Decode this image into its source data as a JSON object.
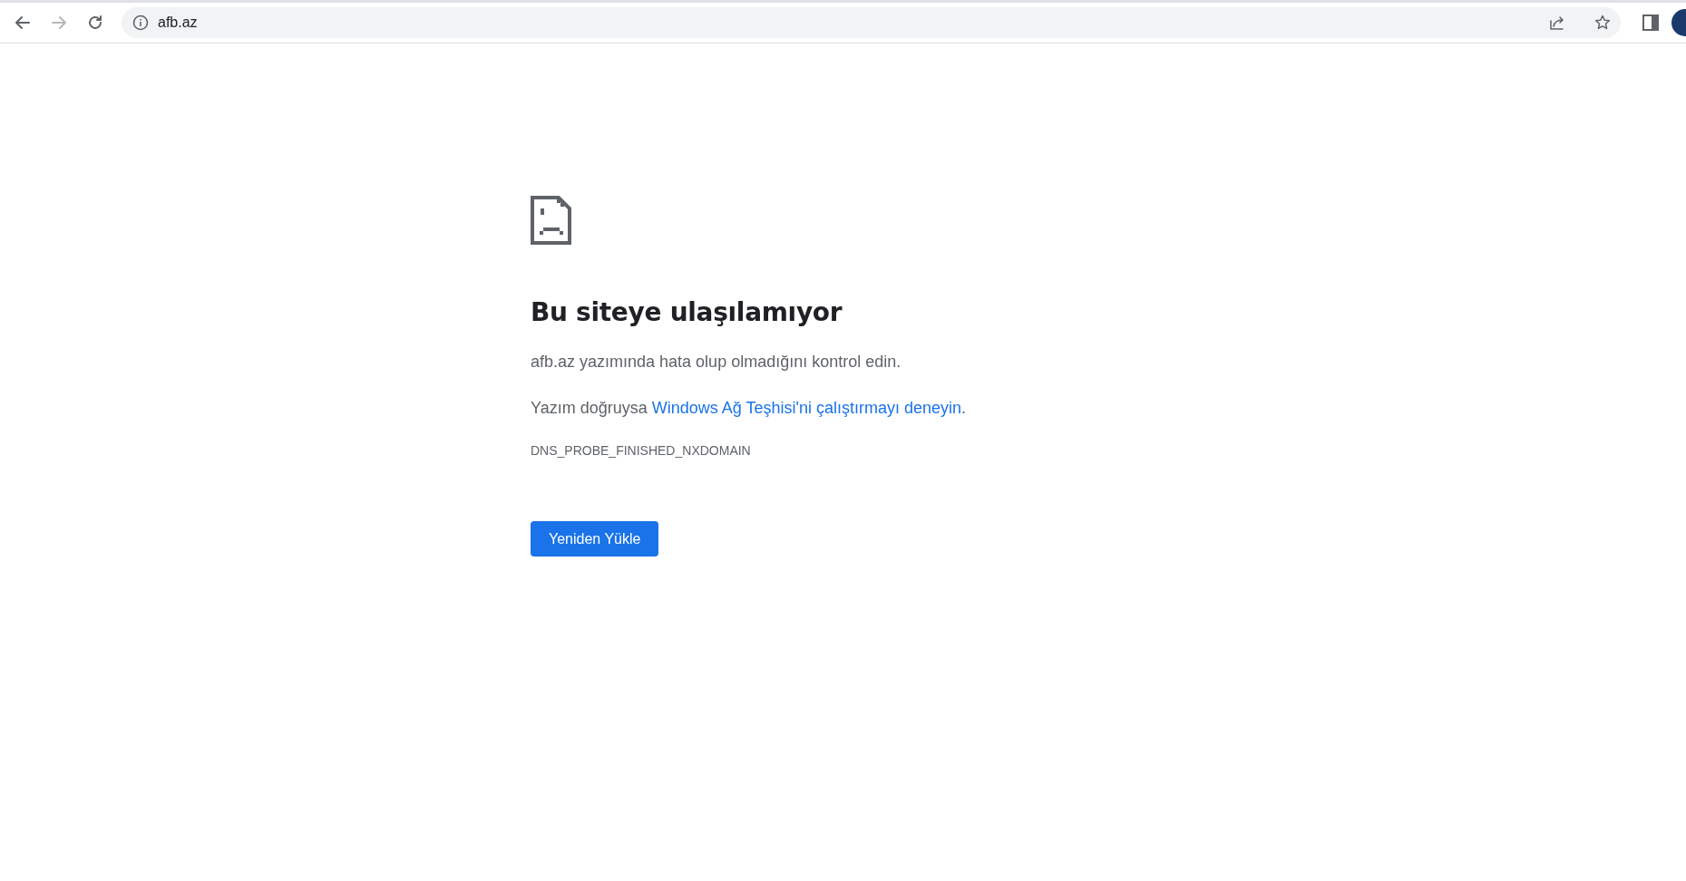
{
  "toolbar": {
    "back": {
      "disabled": false
    },
    "forward": {
      "disabled": true
    },
    "address": "afb.az"
  },
  "error": {
    "title": "Bu siteye ulaşılamıyor",
    "summary": "afb.az yazımında hata olup olmadığını kontrol edin.",
    "suggestion": {
      "prefix": "Yazım doğruysa ",
      "link": "Windows Ağ Teşhisi'ni çalıştırmayı deneyin",
      "suffix": "."
    },
    "code": "DNS_PROBE_FINISHED_NXDOMAIN",
    "button": "Yeniden Yükle"
  }
}
